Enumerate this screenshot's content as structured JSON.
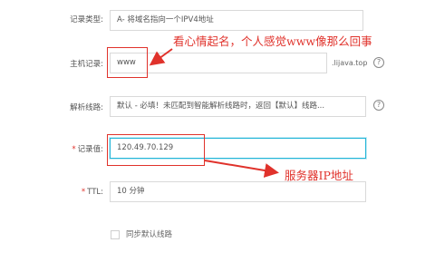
{
  "record_type": {
    "label": "记录类型:",
    "value": "A- 将域名指向一个IPV4地址"
  },
  "host_record": {
    "label": "主机记录:",
    "value": "www",
    "suffix": ".lijava.top",
    "help": "?"
  },
  "resolve_line": {
    "label": "解析线路:",
    "value": "默认 - 必填！未匹配到智能解析线路时，返回【默认】线路...",
    "help": "?"
  },
  "record_value": {
    "label": "记录值:",
    "required_mark": "*",
    "value": "120.49.70.129"
  },
  "ttl": {
    "label": "TTL:",
    "required_mark": "*",
    "value": "10 分钟"
  },
  "sync_default": {
    "label": "同步默认线路",
    "checked": false
  },
  "annotations": {
    "host_note": "看心情起名，个人感觉www像那么回事",
    "value_note": "服务器IP地址",
    "color": "#e0322b"
  }
}
